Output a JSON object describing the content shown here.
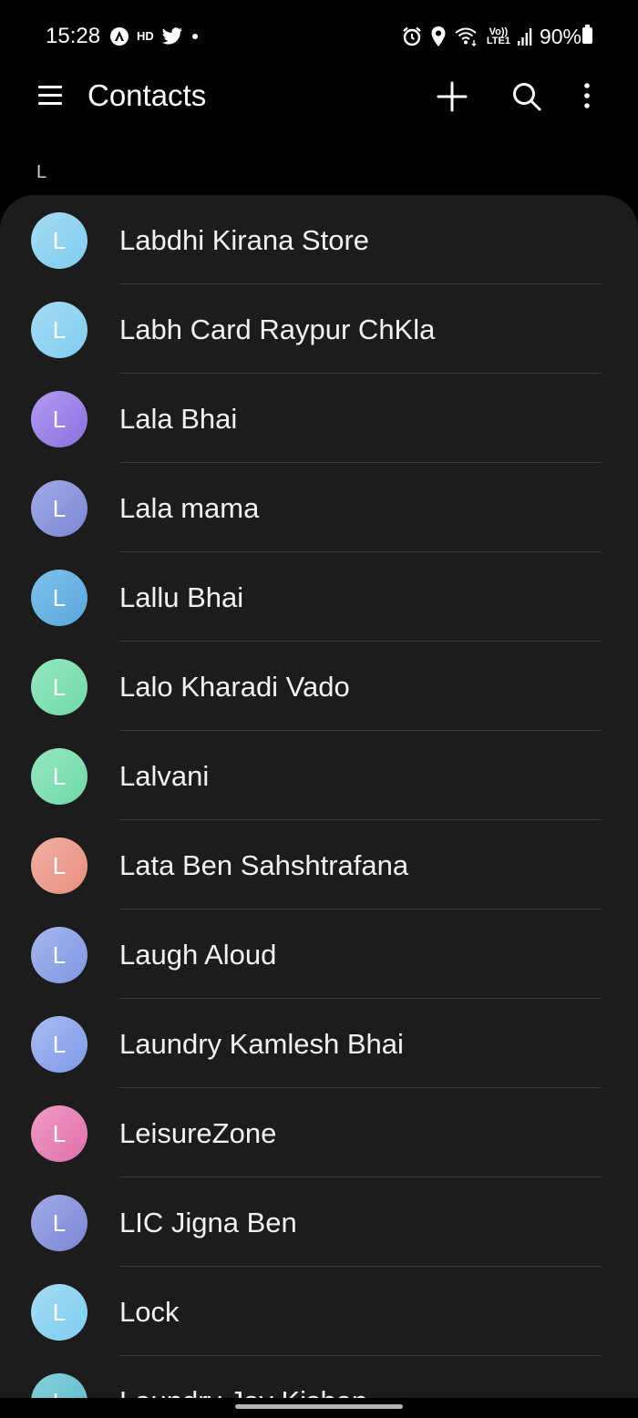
{
  "status_bar": {
    "time": "15:28",
    "left_icons": [
      "android-auto-icon",
      "hd-icon",
      "twitter-icon",
      "notification-dot-icon"
    ],
    "right_icons": [
      "alarm-icon",
      "location-icon",
      "wifi-calling-icon",
      "volte-lte-icon",
      "signal-icon",
      "battery-icon"
    ],
    "volte_label_top": "Vo))",
    "volte_label_bottom": "LTE1",
    "hd_label": "HD",
    "battery_text": "90%"
  },
  "app_bar": {
    "title": "Contacts",
    "menu_icon": "hamburger-menu-icon",
    "add_icon": "plus-icon",
    "search_icon": "search-icon",
    "more_icon": "more-vertical-icon"
  },
  "section": {
    "letter": "L"
  },
  "contacts": [
    {
      "initial": "L",
      "name": "Labdhi Kirana Store",
      "color": "#7ecdf0",
      "color2": "#a6dcf5"
    },
    {
      "initial": "L",
      "name": "Labh Card Raypur ChKla",
      "color": "#7ecdf0",
      "color2": "#a6dcf5"
    },
    {
      "initial": "L",
      "name": "Lala Bhai",
      "color": "#8b6fe0",
      "color2": "#b49bf0"
    },
    {
      "initial": "L",
      "name": "Lala mama",
      "color": "#7b86d6",
      "color2": "#a2abe6"
    },
    {
      "initial": "L",
      "name": "Lallu Bhai",
      "color": "#5aa7dd",
      "color2": "#7dc2ec"
    },
    {
      "initial": "L",
      "name": "Lalo Kharadi Vado",
      "color": "#6ed9a6",
      "color2": "#96e8c1"
    },
    {
      "initial": "L",
      "name": "Lalvani",
      "color": "#6ed9a6",
      "color2": "#96e8c1"
    },
    {
      "initial": "L",
      "name": "Lata Ben Sahshtrafana",
      "color": "#e88e7e",
      "color2": "#f2b0a4"
    },
    {
      "initial": "L",
      "name": "Laugh Aloud",
      "color": "#7f96e2",
      "color2": "#a6b8ef"
    },
    {
      "initial": "L",
      "name": "Laundry Kamlesh Bhai",
      "color": "#7f9ae8",
      "color2": "#a9bcf3"
    },
    {
      "initial": "L",
      "name": "LeisureZone",
      "color": "#e06fa8",
      "color2": "#ef9cc6"
    },
    {
      "initial": "L",
      "name": "LIC Jigna Ben",
      "color": "#7b86d6",
      "color2": "#a2abe6"
    },
    {
      "initial": "L",
      "name": "Lock",
      "color": "#7ecdf0",
      "color2": "#a6dcf5"
    },
    {
      "initial": "L",
      "name": "Laundry Jay Kishan",
      "color": "#5ab9c9",
      "color2": "#86d1dc"
    }
  ]
}
